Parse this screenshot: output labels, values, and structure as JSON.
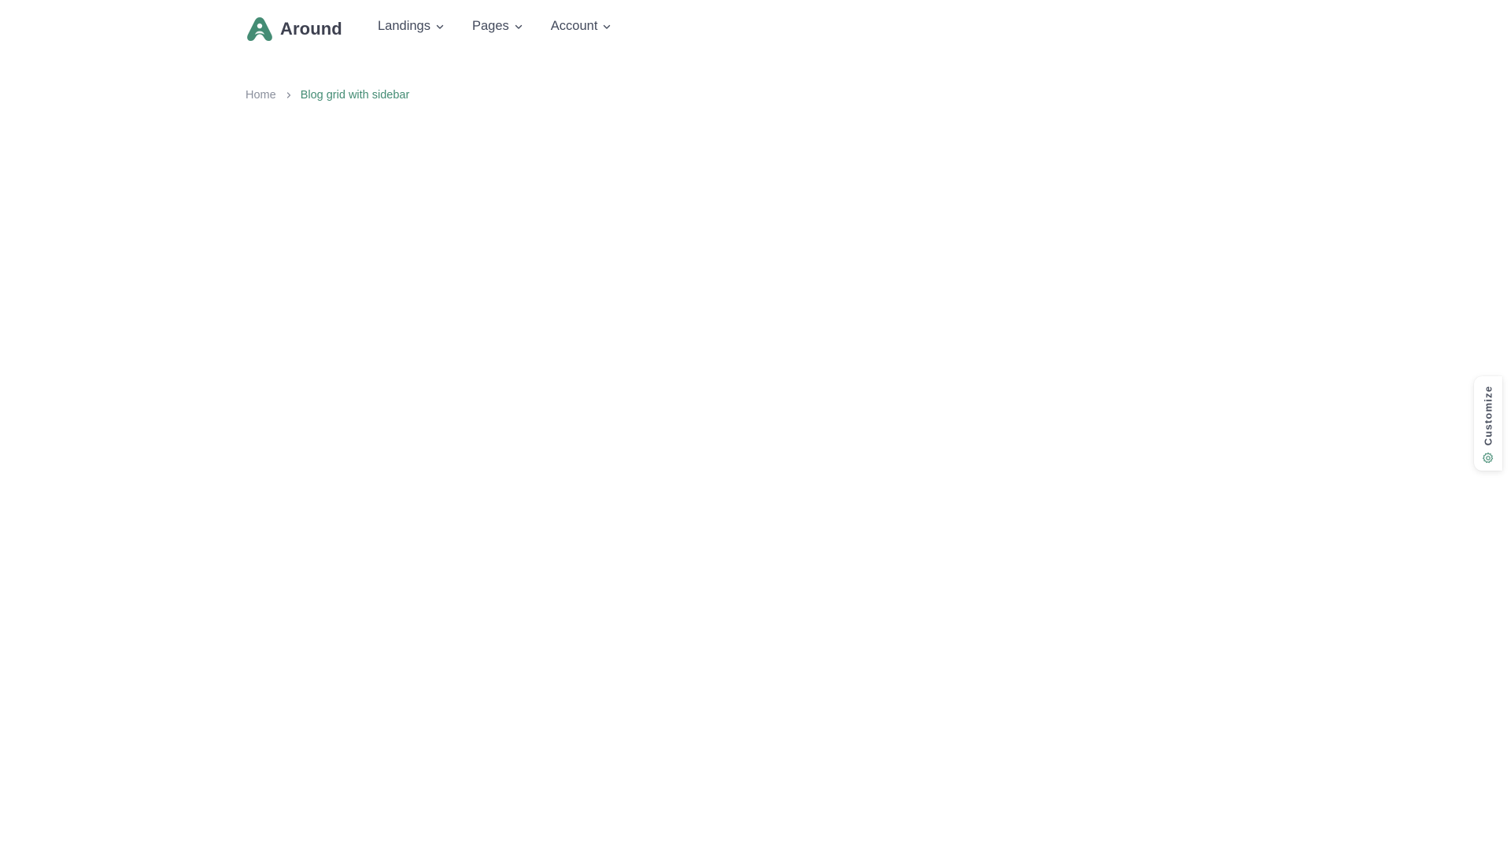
{
  "brand": {
    "name": "Around",
    "logo_icon": "around-logo-icon",
    "accent_color": "#448c74"
  },
  "nav": {
    "items": [
      {
        "label": "Landings",
        "icon": "chevron-down-icon"
      },
      {
        "label": "Pages",
        "icon": "chevron-down-icon"
      },
      {
        "label": "Account",
        "icon": "chevron-down-icon"
      }
    ]
  },
  "breadcrumb": {
    "home": "Home",
    "separator_icon": "chevron-right-icon",
    "current": "Blog grid with sidebar"
  },
  "customize": {
    "label": "Customize",
    "icon": "gear-icon"
  }
}
